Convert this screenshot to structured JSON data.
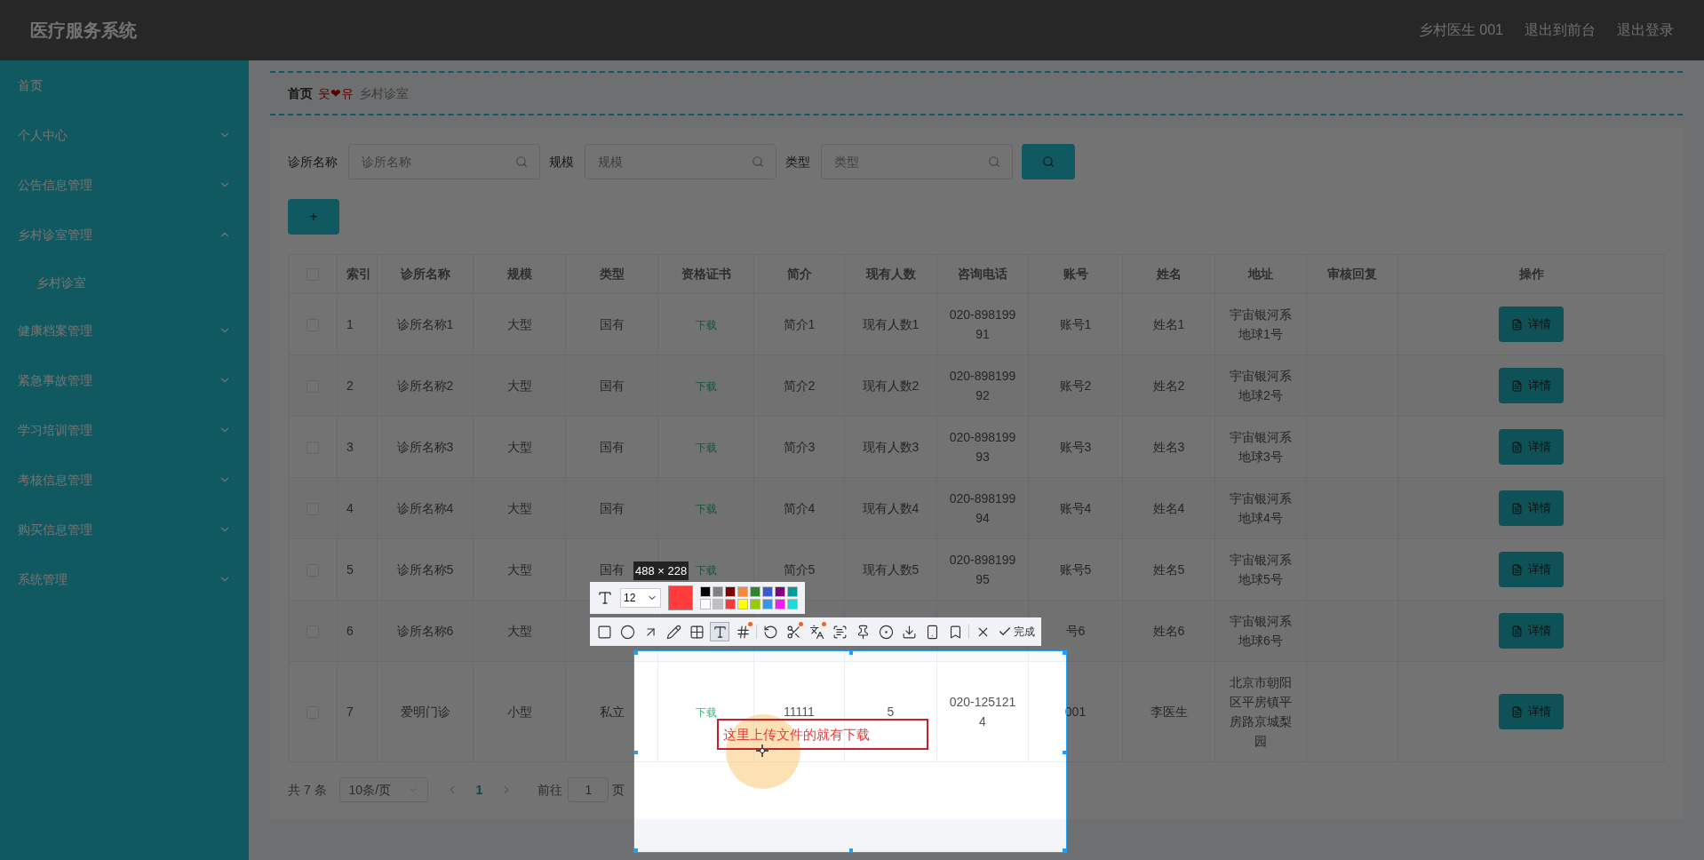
{
  "header": {
    "title": "医疗服务系统",
    "links": [
      "乡村医生 001",
      "退出到前台",
      "退出登录"
    ]
  },
  "sidebar": {
    "items": [
      {
        "label": "首页",
        "kind": "link"
      },
      {
        "label": "个人中心",
        "kind": "menu",
        "expanded": false
      },
      {
        "label": "公告信息管理",
        "kind": "menu",
        "expanded": false
      },
      {
        "label": "乡村诊室管理",
        "kind": "menu",
        "expanded": true,
        "children": [
          {
            "label": "乡村诊室"
          }
        ]
      },
      {
        "label": "健康档案管理",
        "kind": "menu",
        "expanded": false
      },
      {
        "label": "紧急事故管理",
        "kind": "menu",
        "expanded": false
      },
      {
        "label": "学习培训管理",
        "kind": "menu",
        "expanded": false
      },
      {
        "label": "考核信息管理",
        "kind": "menu",
        "expanded": false
      },
      {
        "label": "购买信息管理",
        "kind": "menu",
        "expanded": false
      },
      {
        "label": "系统管理",
        "kind": "menu",
        "expanded": false
      }
    ]
  },
  "breadcrumb": [
    {
      "text": "首页",
      "kind": "current"
    },
    {
      "text": "웃❤유",
      "kind": "separator"
    },
    {
      "text": "乡村诊室",
      "kind": "page"
    }
  ],
  "search": {
    "fields": [
      {
        "label": "诊所名称",
        "placeholder": "诊所名称"
      },
      {
        "label": "规模",
        "placeholder": "规模"
      },
      {
        "label": "类型",
        "placeholder": "类型"
      }
    ]
  },
  "add_button": "+",
  "table": {
    "all_checked": false,
    "columns": [
      "索引",
      "诊所名称",
      "规模",
      "类型",
      "资格证书",
      "简介",
      "现有人数",
      "咨询电话",
      "账号",
      "姓名",
      "地址",
      "审核回复",
      "操作"
    ],
    "rows": [
      {
        "checked": false,
        "cells": [
          "1",
          "诊所名称1",
          "大型",
          "国有",
          "下载",
          "简介1",
          "现有人数1",
          "020-89819991",
          "账号1",
          "姓名1",
          "宇宙银河系地球1号",
          null
        ],
        "action": "详情"
      },
      {
        "checked": false,
        "cells": [
          "2",
          "诊所名称2",
          "大型",
          "国有",
          "下载",
          "简介2",
          "现有人数2",
          "020-89819992",
          "账号2",
          "姓名2",
          "宇宙银河系地球2号",
          null
        ],
        "action": "详情"
      },
      {
        "checked": false,
        "cells": [
          "3",
          "诊所名称3",
          "大型",
          "国有",
          "下载",
          "简介3",
          "现有人数3",
          "020-89819993",
          "账号3",
          "姓名3",
          "宇宙银河系地球3号",
          null
        ],
        "action": "详情"
      },
      {
        "checked": false,
        "cells": [
          "4",
          "诊所名称4",
          "大型",
          "国有",
          "下载",
          "简介4",
          "现有人数4",
          "020-89819994",
          "账号4",
          "姓名4",
          "宇宙银河系地球4号",
          null
        ],
        "action": "详情"
      },
      {
        "checked": false,
        "cells": [
          "5",
          "诊所名称5",
          "大型",
          "国有",
          "下载",
          "简介5",
          "现有人数5",
          "020-89819995",
          "账号5",
          "姓名5",
          "宇宙银河系地球5号",
          null
        ],
        "action": "详情"
      },
      {
        "checked": false,
        "cells": [
          "6",
          "诊所名称6",
          "大型",
          null,
          null,
          null,
          null,
          null,
          "号6",
          "姓名6",
          "宇宙银河系地球6号",
          null
        ],
        "action": "详情"
      },
      {
        "checked": false,
        "cells": [
          "7",
          "爱明门诊",
          "小型",
          "私立",
          "下载",
          "11111",
          "5",
          "020-1251214",
          "001",
          "李医生",
          "北京市朝阳区平房镇平房路京城梨园",
          null
        ],
        "action": "详情"
      }
    ]
  },
  "pagination": {
    "total": "共 7 条",
    "page_size": "10条/页",
    "pages": [
      {
        "label": "1",
        "selected": true
      }
    ],
    "goto_label": "前往",
    "goto_value": "1",
    "goto_suffix": "页"
  },
  "capture_tool": {
    "size": "488 × 228",
    "font_size": "12",
    "current_swatch": {
      "color": "#ff3b3b"
    },
    "palette": [
      {
        "color": "#000000"
      },
      {
        "color": "#808080"
      },
      {
        "color": "#800000"
      },
      {
        "color": "#f7883a"
      },
      {
        "color": "#308430"
      },
      {
        "color": "#385ad3"
      },
      {
        "color": "#800080"
      },
      {
        "color": "#009999"
      },
      {
        "color": "#ffffff"
      },
      {
        "color": "#c0c0c0"
      },
      {
        "color": "#fb3838"
      },
      {
        "color": "#ffff00"
      },
      {
        "color": "#99cc00"
      },
      {
        "color": "#3894e4"
      },
      {
        "color": "#f31bf3"
      },
      {
        "color": "#16dcdc"
      }
    ],
    "tools": [
      {
        "kind": "rect",
        "selected": false,
        "badge": false
      },
      {
        "kind": "ellipse",
        "selected": false,
        "badge": false
      },
      {
        "kind": "arrow",
        "selected": false,
        "badge": false
      },
      {
        "kind": "pencil",
        "selected": false,
        "badge": false
      },
      {
        "kind": "mosaic",
        "selected": false,
        "badge": false
      },
      {
        "kind": "text",
        "selected": true,
        "badge": false
      },
      {
        "kind": "number",
        "selected": false,
        "badge": true
      },
      {
        "kind": "divider"
      },
      {
        "kind": "undo",
        "selected": false,
        "badge": false
      },
      {
        "kind": "cut",
        "selected": false,
        "badge": true
      },
      {
        "kind": "translate",
        "selected": false,
        "badge": true
      },
      {
        "kind": "scan",
        "selected": false,
        "badge": false
      },
      {
        "kind": "pin",
        "selected": false,
        "badge": false
      },
      {
        "kind": "record",
        "selected": false,
        "badge": false
      },
      {
        "kind": "download",
        "selected": false,
        "badge": false
      },
      {
        "kind": "phone",
        "selected": false,
        "badge": false
      },
      {
        "kind": "bookmark",
        "selected": false,
        "badge": false
      },
      {
        "kind": "divider"
      },
      {
        "kind": "close",
        "selected": false,
        "badge": false
      }
    ],
    "done_label": "完成",
    "annotation": "这里上传文件的就有下载"
  }
}
